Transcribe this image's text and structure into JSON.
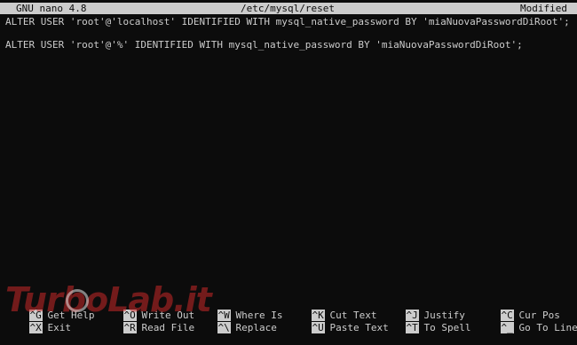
{
  "titlebar": {
    "app": "GNU nano 4.8",
    "file": "/etc/mysql/reset",
    "status": "Modified"
  },
  "editor": {
    "lines": [
      "ALTER USER 'root'@'localhost' IDENTIFIED WITH mysql_native_password BY 'miaNuovaPasswordDiRoot';",
      "",
      "ALTER USER 'root'@'%' IDENTIFIED WITH mysql_native_password BY 'miaNuovaPasswordDiRoot';"
    ]
  },
  "shortcuts": {
    "row1": [
      {
        "key": "^G",
        "label": "Get Help"
      },
      {
        "key": "^O",
        "label": "Write Out"
      },
      {
        "key": "^W",
        "label": "Where Is"
      },
      {
        "key": "^K",
        "label": "Cut Text"
      },
      {
        "key": "^J",
        "label": "Justify"
      },
      {
        "key": "^C",
        "label": "Cur Pos"
      }
    ],
    "row2": [
      {
        "key": "^X",
        "label": "Exit"
      },
      {
        "key": "^R",
        "label": "Read File"
      },
      {
        "key": "^\\",
        "label": "Replace"
      },
      {
        "key": "^U",
        "label": "Paste Text"
      },
      {
        "key": "^T",
        "label": "To Spell"
      },
      {
        "key": "^_",
        "label": "Go To Line"
      }
    ]
  },
  "watermark": {
    "text": "TurboLab.it"
  }
}
